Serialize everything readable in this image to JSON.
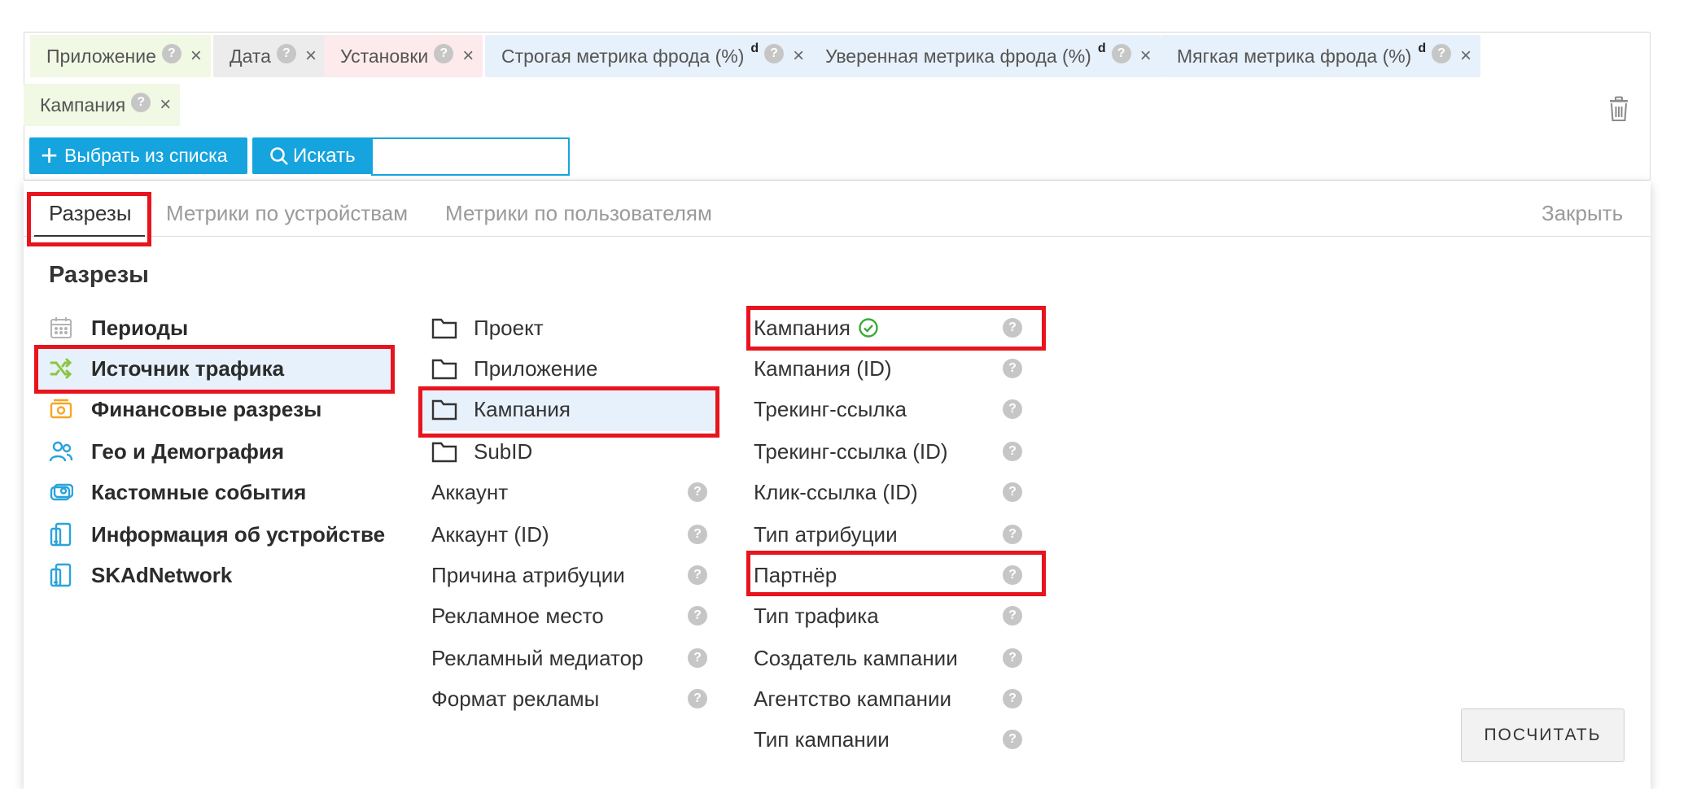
{
  "chips": [
    {
      "label": "Приложение",
      "sup": "",
      "color": "green"
    },
    {
      "label": "Дата",
      "sup": "",
      "color": "gray"
    },
    {
      "label": "Установки",
      "sup": "",
      "color": "pink"
    },
    {
      "label": "Строгая метрика фрода (%)",
      "sup": "d",
      "color": "blue"
    },
    {
      "label": "Уверенная метрика фрода (%)",
      "sup": "d",
      "color": "blue"
    },
    {
      "label": "Мягкая метрика фрода (%)",
      "sup": "d",
      "color": "blue"
    },
    {
      "label": "Кампания",
      "sup": "",
      "color": "green"
    }
  ],
  "toolbar": {
    "pick_label": "Выбрать из списка",
    "search_label": "Искать",
    "search_value": ""
  },
  "tabs": [
    {
      "label": "Разрезы",
      "active": true
    },
    {
      "label": "Метрики по устройствам",
      "active": false
    },
    {
      "label": "Метрики по пользователям",
      "active": false
    }
  ],
  "close_label": "Закрыть",
  "section_title": "Разрезы",
  "categories": [
    {
      "label": "Периоды",
      "icon": "calendar-icon"
    },
    {
      "label": "Источник трафика",
      "icon": "shuffle-icon",
      "selected": true
    },
    {
      "label": "Финансовые разрезы",
      "icon": "money-icon"
    },
    {
      "label": "Гео и Демография",
      "icon": "users-icon"
    },
    {
      "label": "Кастомные события",
      "icon": "event-icon"
    },
    {
      "label": "Информация об устройстве",
      "icon": "device-icon"
    },
    {
      "label": "SKAdNetwork",
      "icon": "skad-icon"
    }
  ],
  "folders": [
    {
      "label": "Проект"
    },
    {
      "label": "Приложение"
    },
    {
      "label": "Кампания",
      "selected": true
    },
    {
      "label": "SubID"
    }
  ],
  "middle_attrs": [
    {
      "label": "Аккаунт"
    },
    {
      "label": "Аккаунт (ID)"
    },
    {
      "label": "Причина атрибуции"
    },
    {
      "label": "Рекламное место"
    },
    {
      "label": "Рекламный медиатор"
    },
    {
      "label": "Формат рекламы"
    }
  ],
  "right_attrs": [
    {
      "label": "Кампания",
      "checked": true
    },
    {
      "label": "Кампания (ID)"
    },
    {
      "label": "Трекинг-ссылка"
    },
    {
      "label": "Трекинг-ссылка (ID)"
    },
    {
      "label": "Клик-ссылка (ID)"
    },
    {
      "label": "Тип атрибуции"
    },
    {
      "label": "Партнёр"
    },
    {
      "label": "Тип трафика"
    },
    {
      "label": "Создатель кампании"
    },
    {
      "label": "Агентство кампании"
    },
    {
      "label": "Тип кампании"
    }
  ],
  "help_glyph": "?",
  "remove_glyph": "×",
  "calc_label": "ПОСЧИТАТЬ",
  "colors": {
    "accent": "#16a4de",
    "highlight": "#e8141d",
    "selected_bg": "#e7f1fb",
    "icon_blue": "#2aa3db",
    "icon_green": "#8cc63f",
    "icon_orange": "#f6a623",
    "check_green": "#3aaa35"
  }
}
